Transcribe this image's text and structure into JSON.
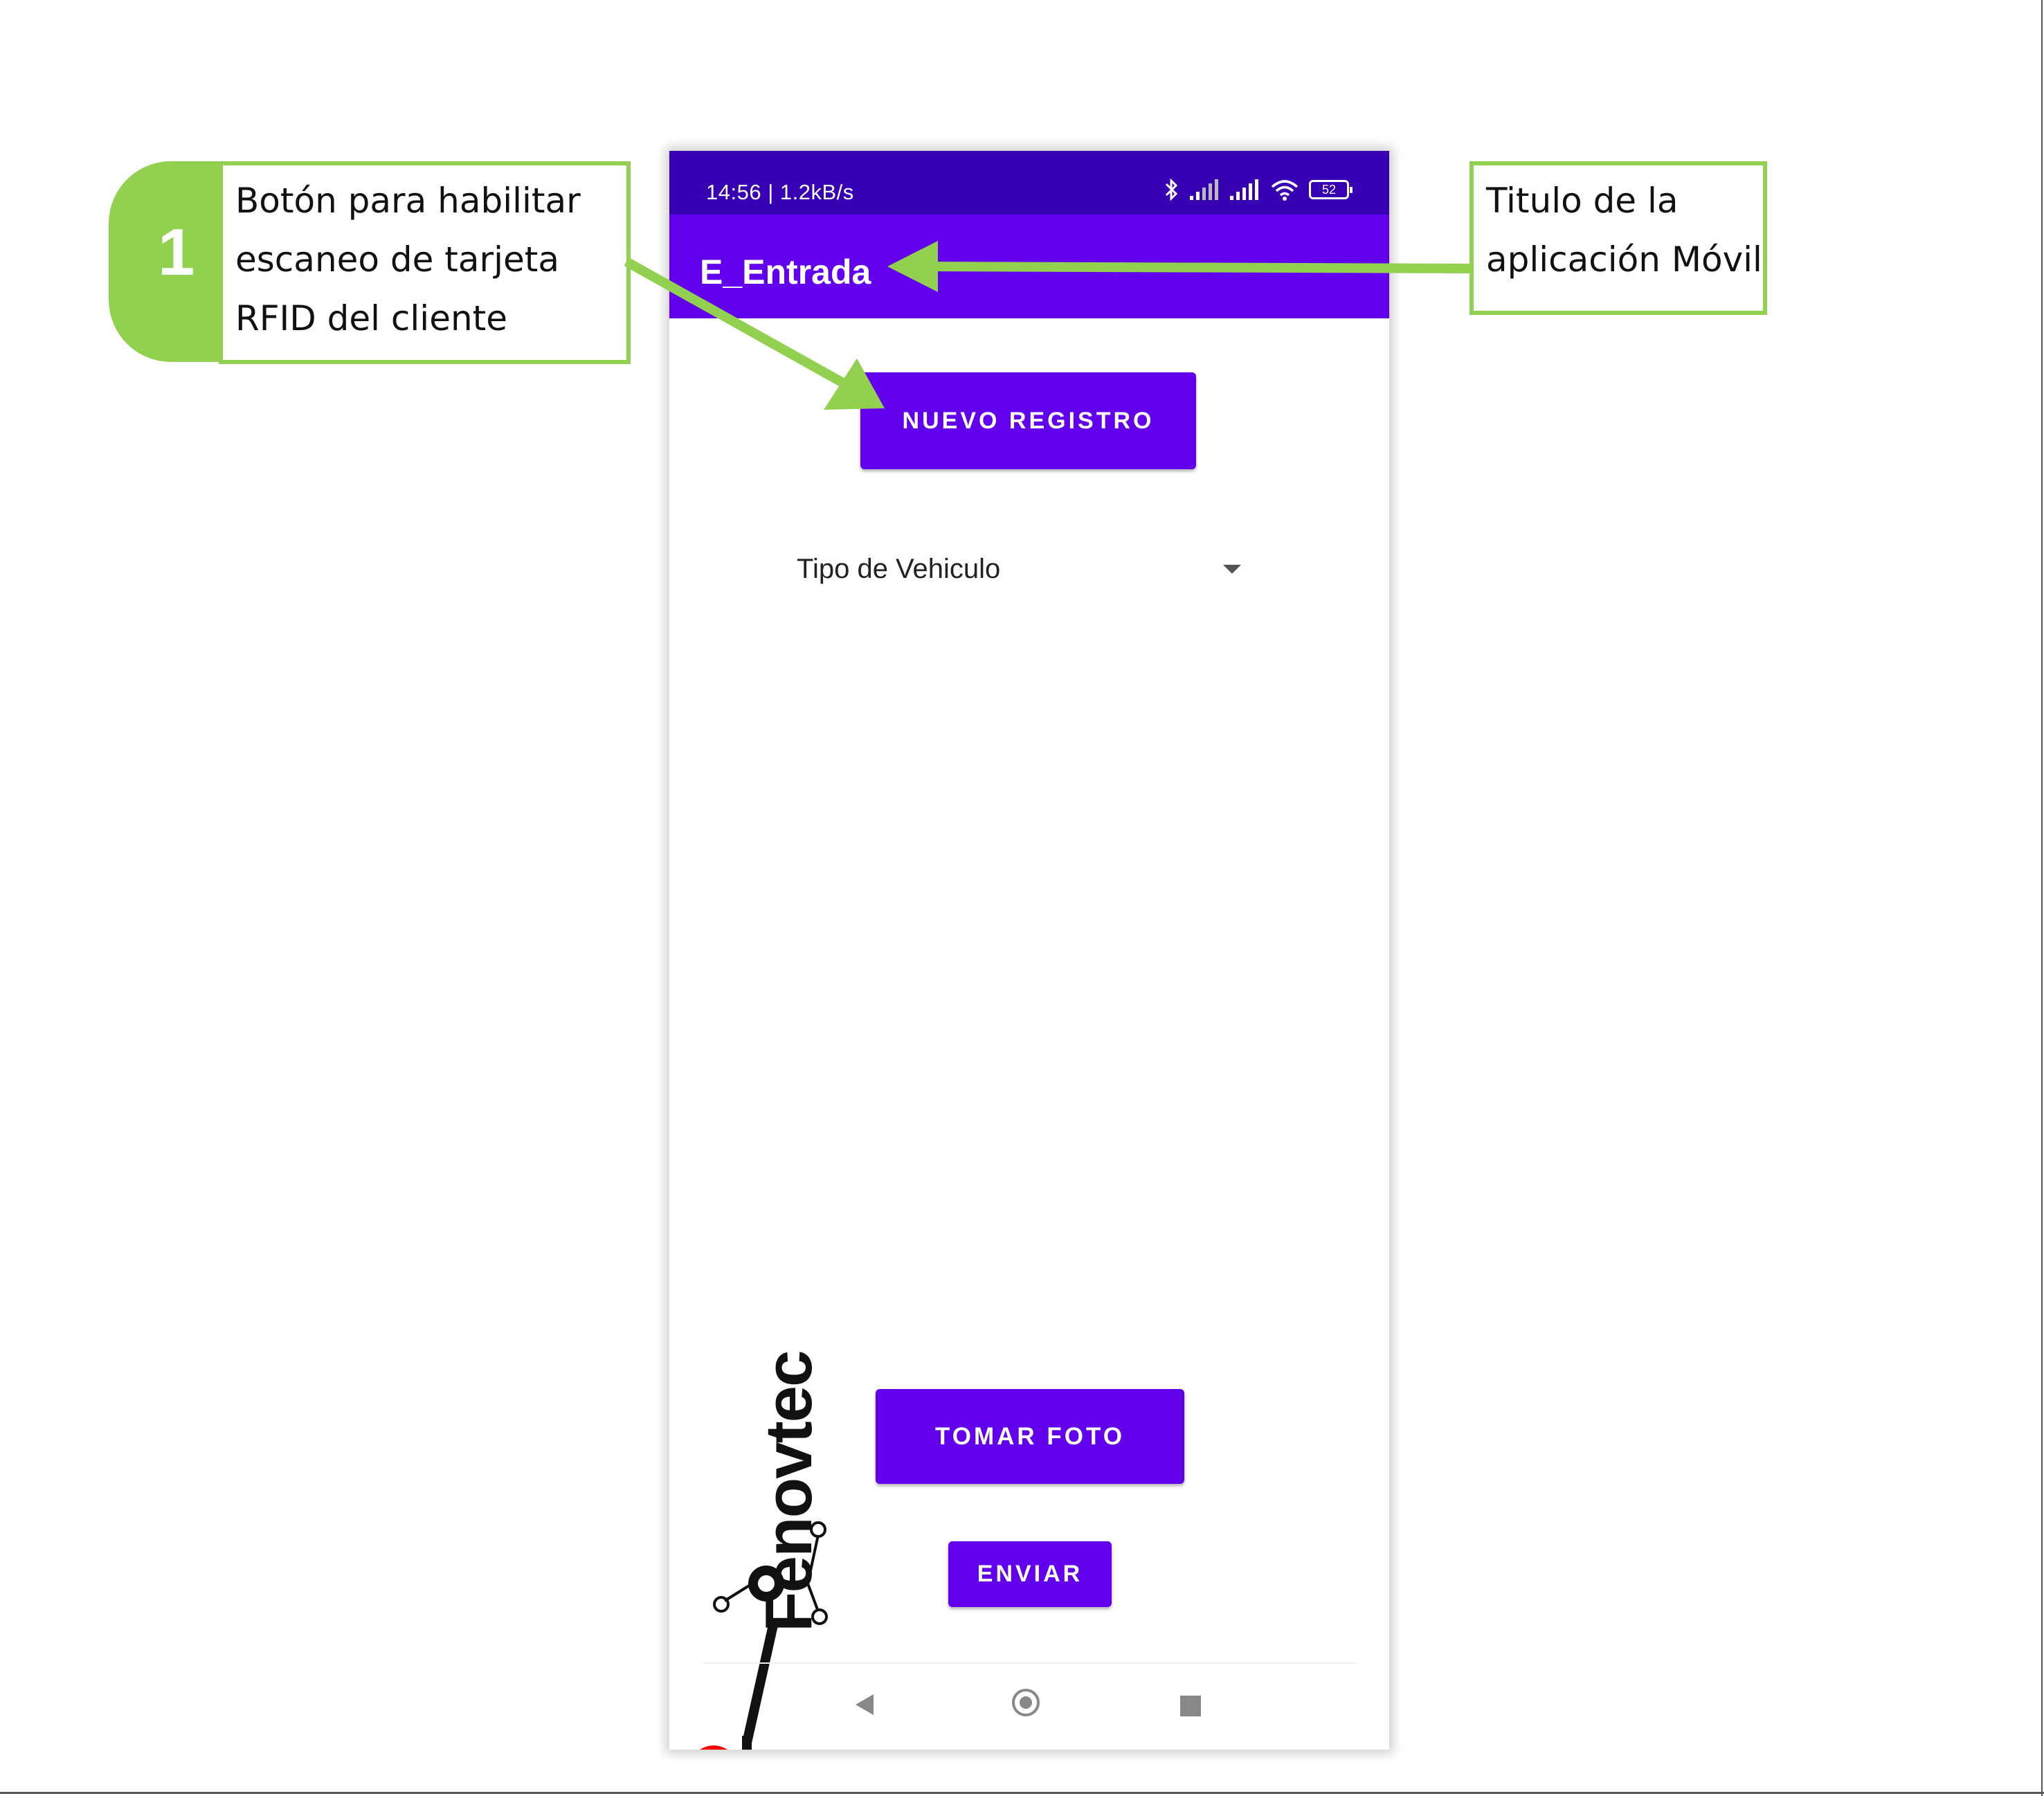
{
  "statusbar": {
    "time_speed": "14:56 | 1.2kB/s",
    "battery": "52"
  },
  "appbar": {
    "title": "E_Entrada"
  },
  "buttons": {
    "nuevo_registro": "NUEVO REGISTRO",
    "tomar_foto": "TOMAR FOTO",
    "enviar": "ENVIAR"
  },
  "spinner": {
    "label": "Tipo de Vehiculo"
  },
  "logo": {
    "text": "Fenovtec"
  },
  "annotation_1": {
    "number": "1",
    "lines": [
      "Botón para  habilitar",
      "escaneo de tarjeta",
      "RFID del cliente"
    ]
  },
  "annotation_2": {
    "lines": [
      "Titulo de la",
      "aplicación Móvil"
    ]
  },
  "colors": {
    "primary": "#6200ee",
    "primary_dark": "#3700b3",
    "annotation_green": "#92d050"
  }
}
